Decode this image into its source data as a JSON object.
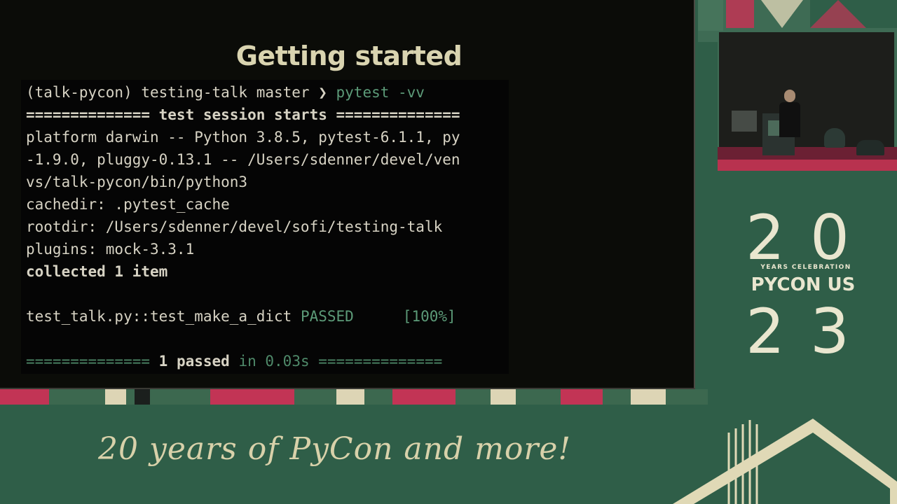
{
  "slide": {
    "title": "Getting started",
    "terminal": {
      "prompt": "(talk-pycon) testing-talk master ❯ ",
      "command": "pytest -vv",
      "lines": [
        "============== test session starts ==============",
        "platform darwin -- Python 3.8.5, pytest-6.1.1, py",
        "-1.9.0, pluggy-0.13.1 -- /Users/sdenner/devel/ven",
        "vs/talk-pycon/bin/python3",
        "cachedir: .pytest_cache",
        "rootdir: /Users/sdenner/devel/sofi/testing-talk",
        "plugins: mock-3.3.1",
        "collected 1 item"
      ],
      "test_name": "test_talk.py::test_make_a_dict ",
      "test_status": "PASSED",
      "test_progress": "[100%]",
      "summary_left": "============== ",
      "summary_passed": "1 passed",
      "summary_in": " in 0.03s ",
      "summary_right": "=============="
    }
  },
  "branding": {
    "digits_top": "20",
    "years_text": "YEARS CELEBRATION",
    "pycon_us": "PYCON US",
    "digits_bottom": "23",
    "tagline": "20 years of PyCon and more!"
  },
  "colors": {
    "background_green": "#2f5e48",
    "cream": "#e9e6cf",
    "pink": "#c23455",
    "terminal_text": "#d7d3c4",
    "terminal_green": "#5c9a78"
  }
}
